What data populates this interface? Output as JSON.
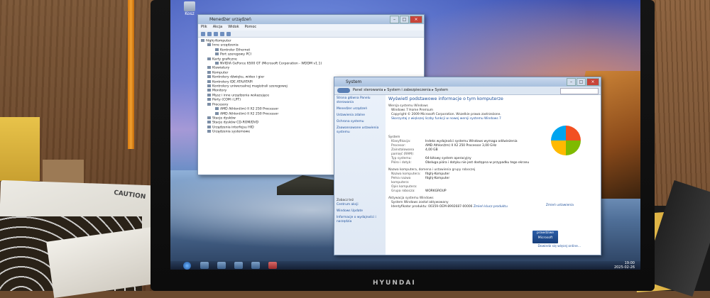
{
  "desktop": {
    "icon_label": "Kosz"
  },
  "device_manager": {
    "title": "Menedżer urządzeń",
    "menu": [
      "Plik",
      "Akcja",
      "Widok",
      "Pomoc"
    ],
    "tree": [
      {
        "level": 0,
        "label": "fdghj-Komputer"
      },
      {
        "level": 1,
        "label": "Inne urządzenia"
      },
      {
        "level": 2,
        "label": "Kontroler Ethernet"
      },
      {
        "level": 2,
        "label": "Port szeregowy PCI"
      },
      {
        "level": 1,
        "label": "Karty graficzne"
      },
      {
        "level": 2,
        "label": "NVIDIA GeForce 6500 GT (Microsoft Corporation - WDDM v1.1)"
      },
      {
        "level": 1,
        "label": "Klawiatury"
      },
      {
        "level": 1,
        "label": "Komputer"
      },
      {
        "level": 1,
        "label": "Kontrolery dźwięku, wideo i gier"
      },
      {
        "level": 1,
        "label": "Kontrolery IDE ATA/ATAPI"
      },
      {
        "level": 1,
        "label": "Kontrolery uniwersalnej magistrali szeregowej"
      },
      {
        "level": 1,
        "label": "Monitory"
      },
      {
        "level": 1,
        "label": "Mysz i inne urządzenia wskazujące"
      },
      {
        "level": 1,
        "label": "Porty (COM i LPT)"
      },
      {
        "level": 1,
        "label": "Procesory"
      },
      {
        "level": 2,
        "label": "AMD Athlon(tm) II X2 250 Processor"
      },
      {
        "level": 2,
        "label": "AMD Athlon(tm) II X2 250 Processor"
      },
      {
        "level": 1,
        "label": "Stacje dysków"
      },
      {
        "level": 1,
        "label": "Stacje dysków CD-ROM/DVD"
      },
      {
        "level": 1,
        "label": "Urządzenia interfejsu HID"
      },
      {
        "level": 1,
        "label": "Urządzenia systemowe"
      }
    ]
  },
  "system": {
    "title": "System",
    "breadcrumb": "Panel sterowania ▸ System i zabezpieczenia ▸ System",
    "side_links": [
      "Strona główna Panelu sterowania",
      "Menedżer urządzeń",
      "Ustawienia zdalne",
      "Ochrona systemu",
      "Zaawansowane ustawienia systemu"
    ],
    "see_also_label": "Zobacz też",
    "see_also": [
      "Centrum akcji",
      "Windows Update",
      "Informacje o wydajności i narzędzia"
    ],
    "heading": "Wyświetl podstawowe informacje o tym komputerze",
    "edition_label": "Wersja systemu Windows",
    "edition": "Windows 7 Home Premium",
    "copyright": "Copyright © 2009 Microsoft Corporation. Wszelkie prawa zastrzeżone.",
    "upgrade_link": "Skorzystaj z większej liczby funkcji w nowej wersji systemu Windows 7",
    "system_label": "System",
    "rows": [
      {
        "k": "Klasyfikacja:",
        "v": "Indeks wydajności systemu Windows wymaga odświeżenia"
      },
      {
        "k": "Procesor:",
        "v": "AMD Athlon(tm) II X2 250 Processor   3,00 GHz"
      },
      {
        "k": "Zainstalowana pamięć (RAM):",
        "v": "4,00 GB"
      },
      {
        "k": "Typ systemu:",
        "v": "64-bitowy system operacyjny"
      },
      {
        "k": "Pióro i dotyk:",
        "v": "Obsługa pióra i dotyku nie jest dostępna w przypadku tego ekranu"
      }
    ],
    "computer_section": "Nazwa komputera, domena i ustawienia grupy roboczej",
    "computer_rows": [
      {
        "k": "Nazwa komputera:",
        "v": "fdghj-Komputer"
      },
      {
        "k": "Pełna nazwa komputera:",
        "v": "fdghj-Komputer"
      },
      {
        "k": "Opis komputera:",
        "v": ""
      },
      {
        "k": "Grupa robocza:",
        "v": "WORKGROUP"
      }
    ],
    "change_settings": "Zmień ustawienia",
    "activation_label": "Aktywacja systemu Windows",
    "activation_status": "System Windows został aktywowany",
    "product_id": "Identyfikator produktu: 00359-OEM-8992687-00006",
    "change_key": "Zmień klucz produktu",
    "genuine_line1": "prawdziwe",
    "genuine_line2": "Microsoft",
    "more_info": "Dowiedz się więcej online..."
  },
  "taskbar": {
    "time": "19:00",
    "date": "2025-02-26"
  },
  "monitor": {
    "brand": "HYUNDAI"
  },
  "background": {
    "paper_text": "CAUTION"
  }
}
